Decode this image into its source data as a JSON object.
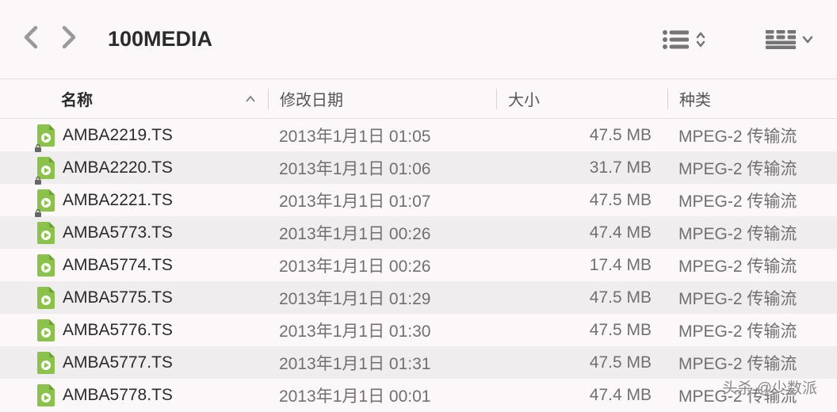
{
  "toolbar": {
    "folder_title": "100MEDIA"
  },
  "columns": {
    "name": "名称",
    "date": "修改日期",
    "size": "大小",
    "kind": "种类"
  },
  "files": [
    {
      "name": "AMBA2219.TS",
      "date": "2013年1月1日 01:05",
      "size": "47.5 MB",
      "kind": "MPEG-2 传输流",
      "locked": true
    },
    {
      "name": "AMBA2220.TS",
      "date": "2013年1月1日 01:06",
      "size": "31.7 MB",
      "kind": "MPEG-2 传输流",
      "locked": true
    },
    {
      "name": "AMBA2221.TS",
      "date": "2013年1月1日 01:07",
      "size": "47.5 MB",
      "kind": "MPEG-2 传输流",
      "locked": true
    },
    {
      "name": "AMBA5773.TS",
      "date": "2013年1月1日 00:26",
      "size": "47.4 MB",
      "kind": "MPEG-2 传输流",
      "locked": false
    },
    {
      "name": "AMBA5774.TS",
      "date": "2013年1月1日 00:26",
      "size": "17.4 MB",
      "kind": "MPEG-2 传输流",
      "locked": false
    },
    {
      "name": "AMBA5775.TS",
      "date": "2013年1月1日 01:29",
      "size": "47.5 MB",
      "kind": "MPEG-2 传输流",
      "locked": false
    },
    {
      "name": "AMBA5776.TS",
      "date": "2013年1月1日 01:30",
      "size": "47.5 MB",
      "kind": "MPEG-2 传输流",
      "locked": false
    },
    {
      "name": "AMBA5777.TS",
      "date": "2013年1月1日 01:31",
      "size": "47.5 MB",
      "kind": "MPEG-2 传输流",
      "locked": false
    },
    {
      "name": "AMBA5778.TS",
      "date": "2013年1月1日 00:01",
      "size": "47.4 MB",
      "kind": "MPEG-2 传输流",
      "locked": false
    }
  ],
  "watermark": "头杀 @少数派"
}
